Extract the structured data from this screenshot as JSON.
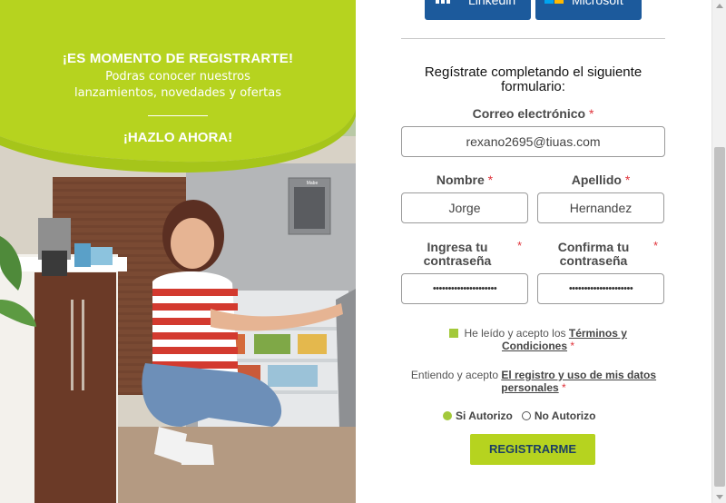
{
  "promo": {
    "headline": "¡ES MOMENTO DE REGISTRARTE!",
    "subtext_line1": "Podras conocer nuestros",
    "subtext_line2": "lanzamientos, novedades y ofertas",
    "cta": "¡HAZLO AHORA!",
    "fridge_brand": "Mabe"
  },
  "sso": {
    "linkedin_label": "Linkedin",
    "microsoft_label": "Microsoft"
  },
  "form": {
    "title": "Regístrate completando el siguiente formulario:",
    "required_mark": "*",
    "email_label": "Correo electrónico",
    "email_value": "rexano2695@tiuas.com",
    "first_name_label": "Nombre",
    "first_name_value": "Jorge",
    "last_name_label": "Apellido",
    "last_name_value": "Hernandez",
    "password_label": "Ingresa tu contraseña",
    "password_value": "•••••••••••••••••••••",
    "confirm_password_label": "Confirma tu contraseña",
    "confirm_password_value": "•••••••••••••••••••••",
    "terms_prefix": "He leído y acepto los",
    "terms_link": "Términos y Condiciones",
    "consent_prefix": "Entiendo y acepto",
    "consent_link": "El registro y uso de mis datos personales",
    "radio_yes": "Si Autorizo",
    "radio_no": "No Autorizo",
    "submit_label": "REGISTRARME"
  },
  "colors": {
    "accent_lime": "#b6d31f",
    "check_green": "#a3c93a",
    "sso_blue": "#1c5a9c",
    "required_red": "#e0333b"
  }
}
